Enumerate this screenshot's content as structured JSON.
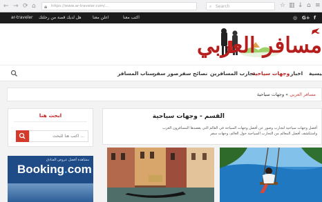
{
  "browser": {
    "url": "https://www.ar-traveler.com/...",
    "search_placeholder": "Search",
    "search_icon": "search-icon"
  },
  "topbar": {
    "links": [
      "اكتب معنا",
      "اعلن معنا",
      "هل لديك قصة من رحلتك",
      "ar-traveler"
    ],
    "social": [
      "f",
      "G+",
      "in"
    ]
  },
  "logo": {
    "text": "مسافر العربي"
  },
  "menu": {
    "items": [
      {
        "label": "رئيسية",
        "active": false
      },
      {
        "label": "اخبار",
        "active": false
      },
      {
        "label": "وجهات سياحية",
        "active": true
      },
      {
        "label": "تجارب المسافرين",
        "active": false
      },
      {
        "label": "نصائح سفر",
        "active": false
      },
      {
        "label": "صور سفر",
        "active": false
      },
      {
        "label": "سناب المسافر",
        "active": false
      }
    ]
  },
  "breadcrumb": {
    "home": "مسافر العربي",
    "separator": "»",
    "current": "وجهات سياحية"
  },
  "sidebar": {
    "title": "ابحث هنا",
    "input_placeholder": "اكتب هنا للبحث ..."
  },
  "ad": {
    "tag": "مشاهدة أفضل عروض الفنادق",
    "brand_main": "Booking",
    "brand_dot": ".",
    "brand_tld": "com"
  },
  "section": {
    "title": "القسم - وجهات سياحية",
    "description": "أفضل وجهات سياحية لتجارب وصور عن أفضل وجهات السياحة في العالم التي يقصدها المسافرون العرب واستكشف أفضل المعالم من التجارب السياحية حول العالم، وجهات سفر"
  },
  "colors": {
    "accent": "#b61d1d",
    "topbar": "#1c1c1c",
    "search_button": "#d43a2c",
    "booking_blue": "#1f4b87"
  }
}
